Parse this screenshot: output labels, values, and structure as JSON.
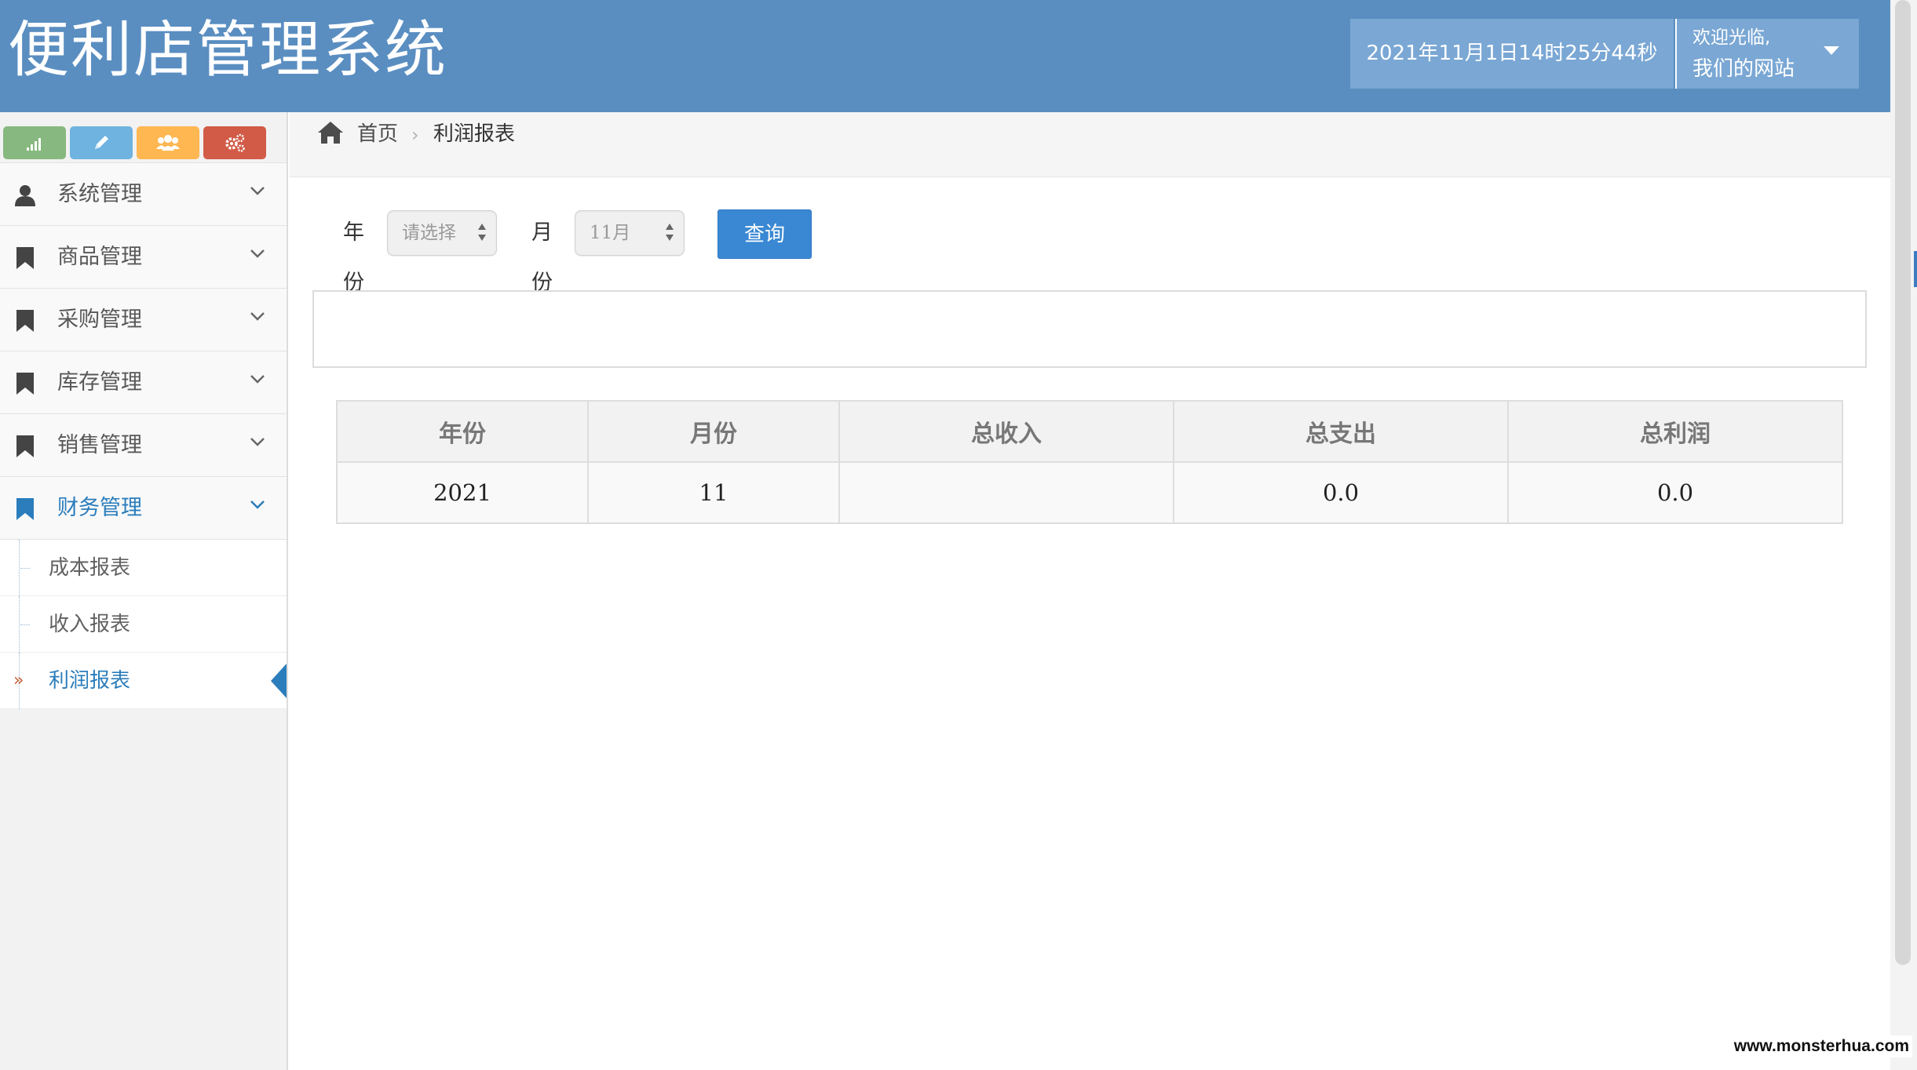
{
  "header": {
    "title": "便利店管理系统",
    "datetime": "2021年11月1日14时25分44秒",
    "welcome": "欢迎光临,",
    "site_name": "我们的网站"
  },
  "sidebar": {
    "shortcuts": [
      {
        "icon": "signal-icon",
        "color": "#87b87f"
      },
      {
        "icon": "pencil-icon",
        "color": "#6fb3e0"
      },
      {
        "icon": "users-icon",
        "color": "#ffb752"
      },
      {
        "icon": "cogs-icon",
        "color": "#d15b47"
      }
    ],
    "items": [
      {
        "label": "系统管理",
        "icon": "user-icon"
      },
      {
        "label": "商品管理",
        "icon": "bookmark-icon"
      },
      {
        "label": "采购管理",
        "icon": "bookmark-icon"
      },
      {
        "label": "库存管理",
        "icon": "bookmark-icon"
      },
      {
        "label": "销售管理",
        "icon": "bookmark-icon"
      },
      {
        "label": "财务管理",
        "icon": "bookmark-icon",
        "active": true
      }
    ],
    "subitems": [
      {
        "label": "成本报表"
      },
      {
        "label": "收入报表"
      },
      {
        "label": "利润报表",
        "active": true
      }
    ]
  },
  "breadcrumb": {
    "home": "首页",
    "current": "利润报表"
  },
  "filter": {
    "year_label": "年份",
    "year_value": "请选择",
    "month_label": "月份",
    "month_value": "11月",
    "query_label": "查询"
  },
  "table": {
    "headers": [
      "年份",
      "月份",
      "总收入",
      "总支出",
      "总利润"
    ],
    "rows": [
      [
        "2021",
        "11",
        "",
        "0.0",
        "0.0"
      ]
    ]
  },
  "watermark": "www.monsterhua.com",
  "colors": {
    "header_bg": "#5a8ec1",
    "accent": "#2b7dbc",
    "query_button": "#3a88d3"
  }
}
